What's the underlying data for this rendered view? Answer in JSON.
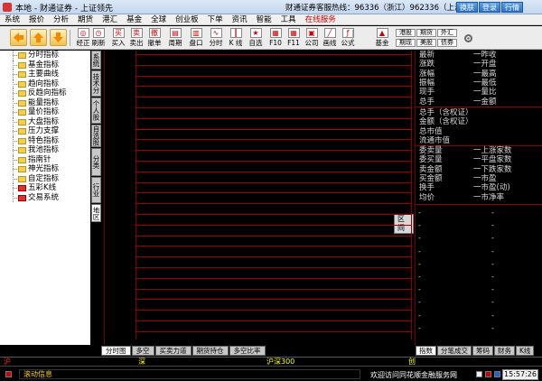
{
  "window": {
    "title": "本地 - 财通证券 - 上证领先",
    "hotline": "财通证券客服热线：96336（浙江）962336（上海）",
    "title_buttons": [
      "换肤",
      "登录",
      "行情"
    ]
  },
  "menu": [
    "系统",
    "报价",
    "分析",
    "期货",
    "港汇",
    "基金",
    "全球",
    "创业板",
    "下单",
    "资讯",
    "智能",
    "工具",
    "在线服务"
  ],
  "toolbar": {
    "tools": [
      {
        "label": "经正",
        "icon": "calibrate-icon",
        "glyph": "◎"
      },
      {
        "label": "刷新",
        "icon": "clock-icon",
        "glyph": "◷"
      },
      {
        "label": "买入",
        "icon": "buy-icon",
        "glyph": "买"
      },
      {
        "label": "卖出",
        "icon": "sell-icon",
        "glyph": "卖"
      },
      {
        "label": "撤单",
        "icon": "cancel-order-icon",
        "glyph": "撤"
      },
      {
        "label": "周期",
        "icon": "period-icon",
        "glyph": "▤"
      },
      {
        "label": "盘口",
        "icon": "orderbook-icon",
        "glyph": "▥"
      },
      {
        "label": "分时",
        "icon": "timeshare-icon",
        "glyph": "∿"
      },
      {
        "label": "K 线",
        "icon": "kline-icon",
        "glyph": "┃"
      },
      {
        "label": "自选",
        "icon": "watchlist-icon",
        "glyph": "★"
      },
      {
        "label": "F10",
        "icon": "f10-icon",
        "glyph": "▦"
      },
      {
        "label": "F11",
        "icon": "f11-icon",
        "glyph": "▦"
      },
      {
        "label": "公司",
        "icon": "company-icon",
        "glyph": "▣"
      },
      {
        "label": "画线",
        "icon": "draw-line-icon",
        "glyph": "╱"
      },
      {
        "label": "公式",
        "icon": "formula-icon",
        "glyph": "ƒ"
      },
      {
        "label": "基金",
        "icon": "fund-icon",
        "glyph": "▲"
      }
    ],
    "small_buttons": [
      "港股",
      "期货",
      "外汇",
      "期现",
      "美股",
      "债券"
    ]
  },
  "tree": [
    "分时指标",
    "基金指标",
    "主要曲线",
    "趋向指标",
    "反趋向指标",
    "能量指标",
    "量价指标",
    "大盘指标",
    "压力支撑",
    "特色指标",
    "我池指标",
    "指南针",
    "神光指标",
    "自定指标",
    "五彩K线",
    "交易系统"
  ],
  "vtabs": [
    "系统",
    "技术分析",
    "个人股",
    "自选股",
    "分类",
    "行业",
    "地区"
  ],
  "grid_label": "区间",
  "right_panel": {
    "top_rows": [
      {
        "l": "最新",
        "r": "一昨收"
      },
      {
        "l": "涨跌",
        "r": "一开盘"
      },
      {
        "l": "涨幅",
        "r": "一最高"
      },
      {
        "l": "振幅",
        "r": "一最低"
      },
      {
        "l": "现手",
        "r": "一量比"
      },
      {
        "l": "总手",
        "r": "一金额"
      }
    ],
    "mid_rows": [
      "总手（含权证）",
      "金额（含权证）",
      "总市值",
      "流通市值"
    ],
    "bottom_rows": [
      {
        "l": "委卖量",
        "r": "一上涨家数"
      },
      {
        "l": "委买量",
        "r": "一平盘家数"
      },
      {
        "l": "卖金额",
        "r": "一下跌家数"
      },
      {
        "l": "买金额",
        "r": "一市盈"
      },
      {
        "l": "换手",
        "r": "一市盈(动)"
      },
      {
        "l": "均价",
        "r": "一市净率"
      }
    ],
    "tabs": [
      "指数",
      "分笔成交",
      "筹码",
      "财务",
      "K线"
    ]
  },
  "bottom_tabs": [
    "分时图",
    "多空",
    "买卖力道",
    "期货持仓",
    "多空比率"
  ],
  "index_strip": [
    {
      "label": "沪",
      "color": "#ff3030"
    },
    {
      "label": "深",
      "color": "#ffff00"
    },
    {
      "label": "沪深300",
      "color": "#ffff00"
    },
    {
      "label": "创",
      "color": "#ffff00"
    }
  ],
  "status": {
    "marquee": "滚动信息",
    "welcome": "欢迎访问同花顺金融服务网",
    "clock": "15:57:26"
  }
}
